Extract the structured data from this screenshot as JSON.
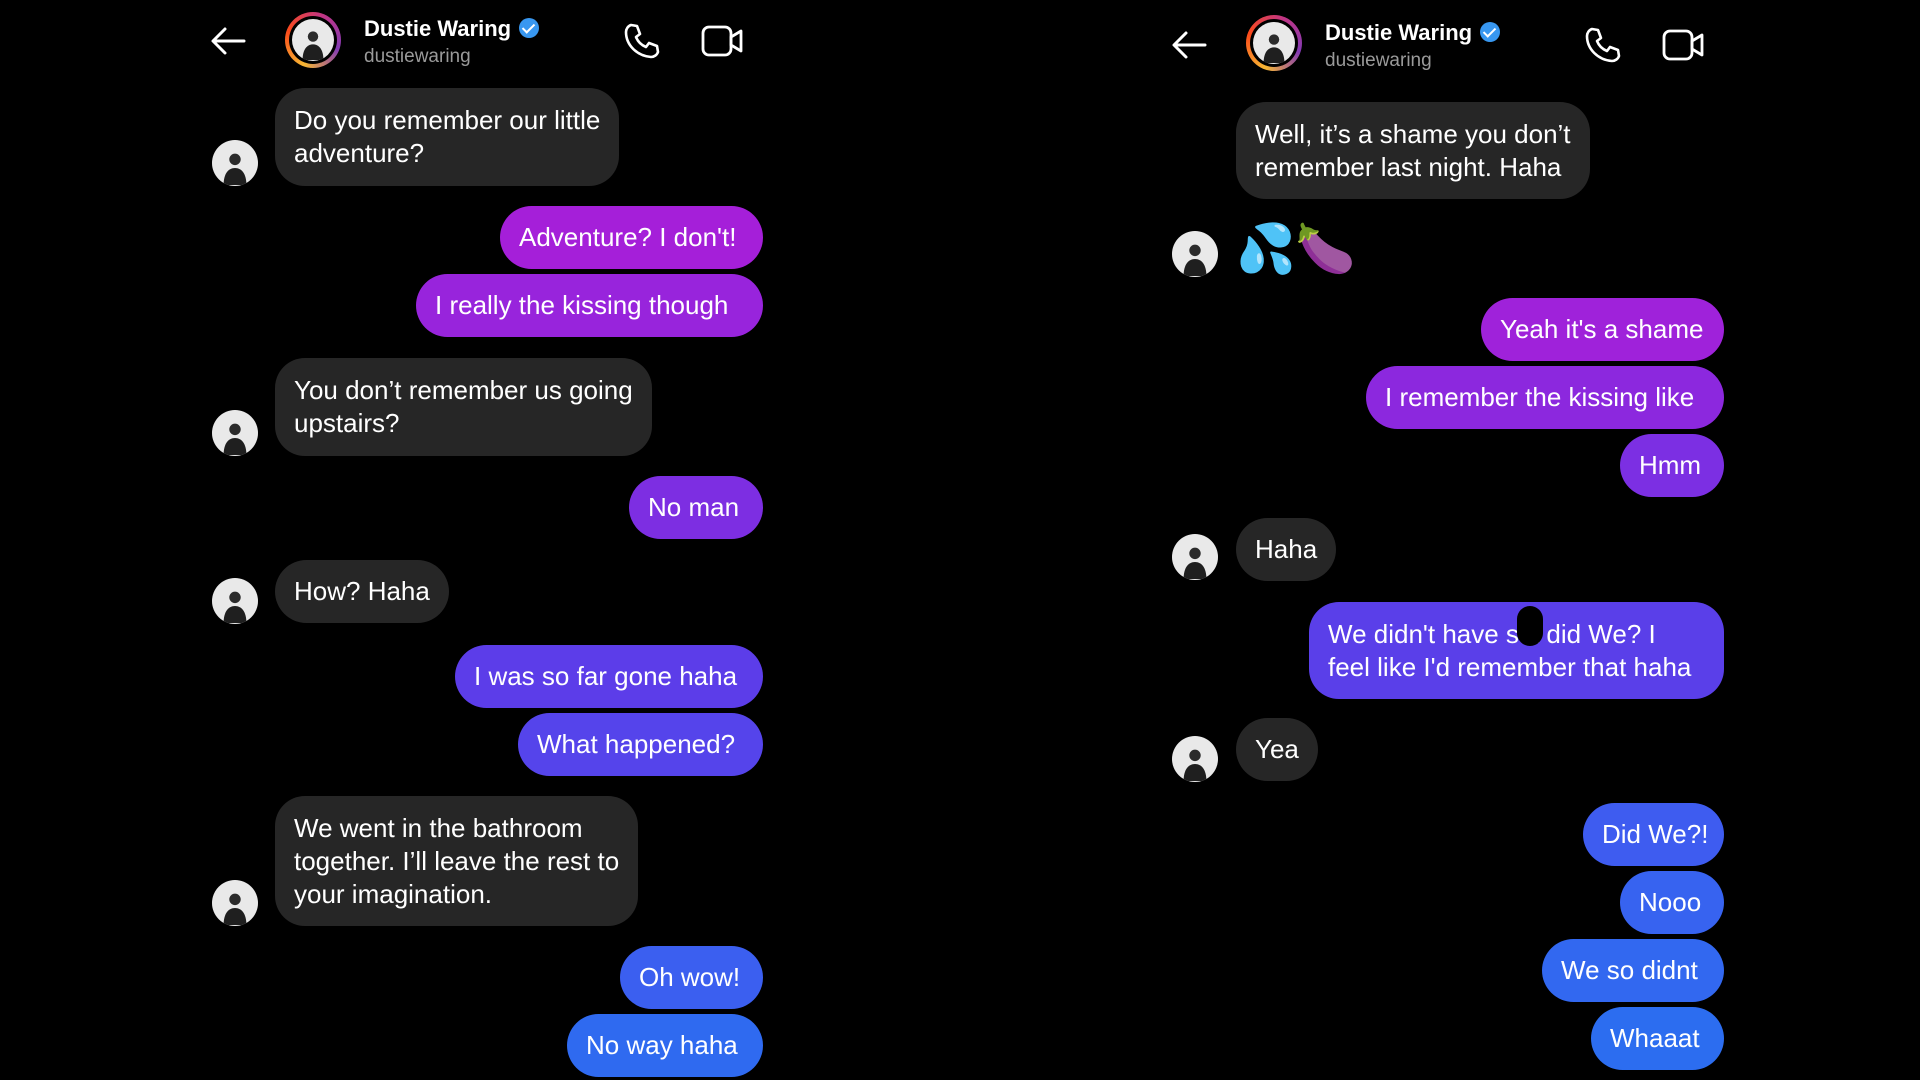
{
  "left": {
    "header": {
      "name": "Dustie Waring",
      "username": "dustiewaring"
    },
    "messages": [
      {
        "text": "Do you remember our little adventure?",
        "lines": [
          "Do you remember our little",
          "adventure?"
        ]
      },
      {
        "text": "Adventure? I don't!"
      },
      {
        "text": "I really the kissing though"
      },
      {
        "text": "You don’t remember us going upstairs?",
        "lines": [
          "You don’t remember us going",
          "upstairs?"
        ]
      },
      {
        "text": "No man"
      },
      {
        "text": "How? Haha"
      },
      {
        "text": "I was so far gone haha"
      },
      {
        "text": "What happened?"
      },
      {
        "text": "We went in the bathroom together. I’ll leave the rest to your imagination.",
        "lines": [
          "We went in the bathroom",
          "together. I’ll leave the rest to",
          "your imagination."
        ]
      },
      {
        "text": "Oh wow!"
      },
      {
        "text": "No way haha"
      }
    ]
  },
  "right": {
    "header": {
      "name": "Dustie Waring",
      "username": "dustiewaring"
    },
    "messages": [
      {
        "text": "Well, it’s a shame you don’t remember last night. Haha",
        "lines": [
          "Well, it’s a shame you don’t",
          "remember last night. Haha"
        ]
      },
      {
        "text": "💦🍆"
      },
      {
        "text": "Yeah it's a shame"
      },
      {
        "text": "I remember the kissing like"
      },
      {
        "text": "Hmm"
      },
      {
        "text": "Haha"
      },
      {
        "text": "We didn't have s  k did We? I feel like I'd remember that haha",
        "lines": [
          "We didn't have s  k did We? I",
          "feel like I'd remember that haha"
        ]
      },
      {
        "text": "Yea"
      },
      {
        "text": "Did We?!"
      },
      {
        "text": "Nooo"
      },
      {
        "text": "We so didnt"
      },
      {
        "text": "Whaaat"
      }
    ]
  },
  "colors": {
    "incoming": "#262626",
    "outgoing_top": "#a020d8",
    "outgoing_mid": "#6a35e8",
    "outgoing_bottom": "#2f6af0",
    "background": "#000000",
    "verified": "#3897f0"
  },
  "icons": [
    "back-arrow-icon",
    "phone-icon",
    "video-camera-icon",
    "verified-badge-icon"
  ]
}
